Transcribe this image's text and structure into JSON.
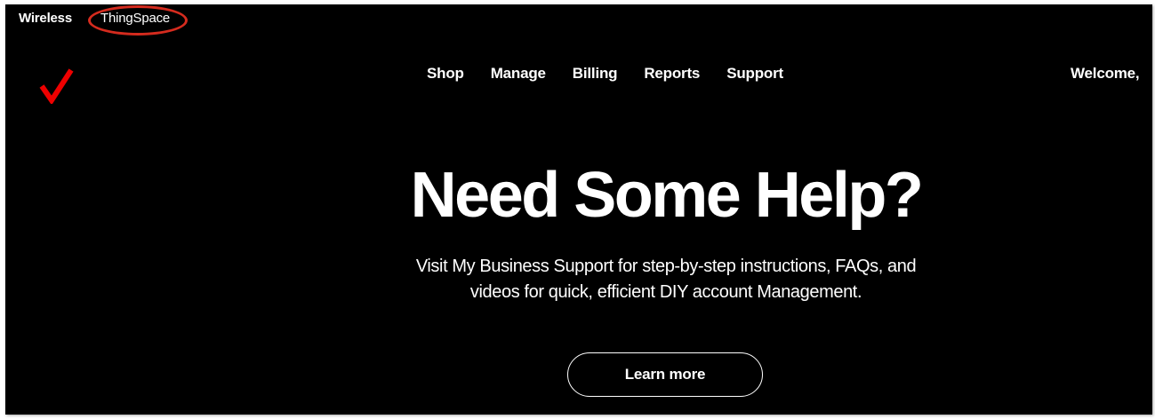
{
  "topbar": {
    "wireless_label": "Wireless",
    "thingspace_label": "ThingSpace"
  },
  "brand": {
    "logo_icon": "verizon-check-icon",
    "accent_color": "#d52b1e"
  },
  "nav": {
    "items": [
      {
        "label": "Shop"
      },
      {
        "label": "Manage"
      },
      {
        "label": "Billing"
      },
      {
        "label": "Reports"
      },
      {
        "label": "Support"
      }
    ]
  },
  "user": {
    "welcome_text": "Welcome,"
  },
  "hero": {
    "title": "Need Some Help?",
    "line1": "Visit My Business Support for step-by-step instructions, FAQs, and",
    "line2": "videos for quick, efficient DIY account Management.",
    "button_label": "Learn more"
  }
}
